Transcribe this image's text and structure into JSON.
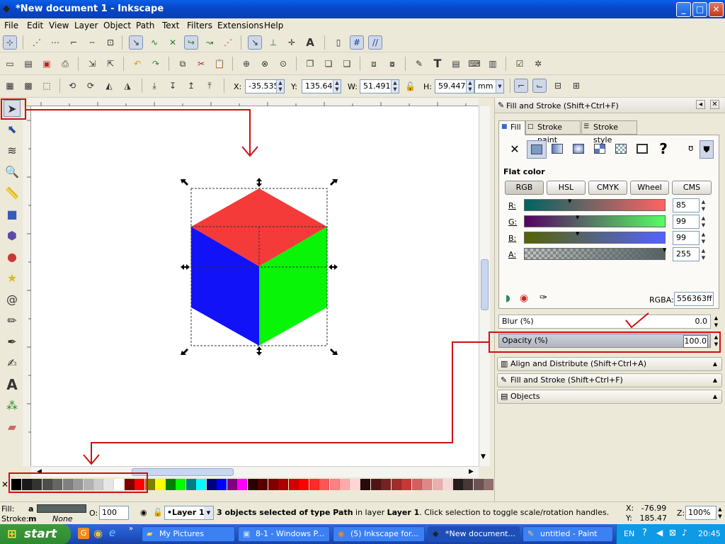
{
  "window": {
    "title": "*New document 1 - Inkscape",
    "minimize": "_",
    "maximize": "□",
    "close": "✕"
  },
  "menu": [
    "File",
    "Edit",
    "View",
    "Layer",
    "Object",
    "Path",
    "Text",
    "Filters",
    "Extensions",
    "Help"
  ],
  "toolbar": {
    "x_label": "X:",
    "x_value": "-35.535",
    "y_label": "Y:",
    "y_value": "135.647",
    "w_label": "W:",
    "w_value": "51.491",
    "h_label": "H:",
    "h_value": "59.447",
    "unit": "mm"
  },
  "cube_colors": {
    "top": "#f53a3a",
    "left": "#1212f8",
    "right": "#08f508"
  },
  "panel": {
    "title": "Fill and Stroke (Shift+Ctrl+F)",
    "tabs": [
      "Fill",
      "Stroke paint",
      "Stroke style"
    ],
    "flat_color": "Flat color",
    "modes": [
      "RGB",
      "HSL",
      "CMYK",
      "Wheel",
      "CMS"
    ],
    "channels": [
      {
        "label": "R:",
        "value": "85"
      },
      {
        "label": "G:",
        "value": "99"
      },
      {
        "label": "B:",
        "value": "99"
      },
      {
        "label": "A:",
        "value": "255"
      }
    ],
    "rgba_label": "RGBA:",
    "rgba_value": "556363ff",
    "blur_label": "Blur (%)",
    "blur_value": "0.0",
    "opacity_label": "Opacity (%)",
    "opacity_value": "100.0",
    "docks": [
      "Align and Distribute (Shift+Ctrl+A)",
      "Fill and Stroke (Shift+Ctrl+F)",
      "Objects"
    ]
  },
  "status": {
    "fill_label": "Fill:",
    "fill_value": "a",
    "stroke_label": "Stroke:",
    "stroke_value": "m",
    "stroke_none": "None",
    "opacity_label": "O:",
    "opacity_value": "100",
    "layer": "•Layer 1",
    "message_pre": "3 objects selected of type ",
    "message_type": "Path",
    "message_mid": " in layer ",
    "message_layer": "Layer 1",
    "message_post": ". Click selection to toggle scale/rotation handles.",
    "x_coord": "X:   -76.99",
    "y_coord": "Y:   185.47",
    "zoom_label": "Z:",
    "zoom_value": "100%"
  },
  "taskbar": {
    "start": "start",
    "tasks": [
      "My Pictures",
      "8-1 - Windows P...",
      "(5) Inkscape for...",
      "*New document...",
      "untitled - Paint"
    ],
    "lang": "EN",
    "time": "20:45"
  },
  "palette_colors": [
    "#000000",
    "#1a1a1a",
    "#333333",
    "#4d4d4d",
    "#666666",
    "#808080",
    "#999999",
    "#b3b3b3",
    "#cccccc",
    "#e6e6e6",
    "#ffffff",
    "#800000",
    "#ff0000",
    "#808000",
    "#ffff00",
    "#008000",
    "#00ff00",
    "#008080",
    "#00ffff",
    "#000080",
    "#0000ff",
    "#800080",
    "#ff00ff",
    "#2b0000",
    "#550000",
    "#800000",
    "#aa0000",
    "#d40000",
    "#ff0000",
    "#ff2a2a",
    "#ff5555",
    "#ff8080",
    "#ffaaaa",
    "#ffd5d5",
    "#280b0b",
    "#501616",
    "#782121",
    "#a02c2c",
    "#c83737",
    "#d35f5f",
    "#de8787",
    "#e9afaf",
    "#f4d7d7",
    "#241c1c",
    "#483737",
    "#6c5353",
    "#916f6f",
    "#ac9393",
    "#c8b7b7",
    "#e3dbdb",
    "#2b1100",
    "#552200",
    "#803300",
    "#aa4400",
    "#d45500",
    "#ff6600",
    "#ff7f2a",
    "#ff9955",
    "#ffb380",
    "#ffccaa",
    "#ffe6d5",
    "#28170b",
    "#502d16",
    "#784421",
    "#a05a2c",
    "#c87137",
    "#d38d5f",
    "#deaa87"
  ]
}
